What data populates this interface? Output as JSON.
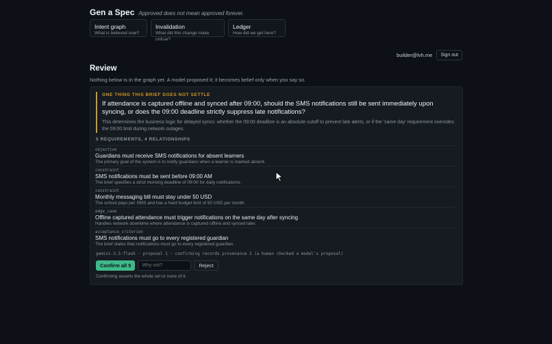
{
  "app": {
    "title": "Gen a Spec",
    "tagline": "Approved does not mean approved forever."
  },
  "nav": [
    {
      "title": "Intent graph",
      "subtitle": "What is believed now?"
    },
    {
      "title": "Invalidation",
      "subtitle": "What did this change make untrue?"
    },
    {
      "title": "Ledger",
      "subtitle": "How did we get here?"
    }
  ],
  "user": {
    "email": "builder@lvh.me",
    "sign_out_label": "Sign out"
  },
  "review": {
    "title": "Review",
    "subtitle": "Nothing below is in the graph yet. A model proposed it; it becomes belief only when you say so."
  },
  "unsettled": {
    "label": "ONE THING THIS BRIEF DOES NOT SETTLE",
    "question": "If attendance is captured offline and synced after 09:00, should the SMS notifications still be sent immediately upon syncing, or does the 09:00 deadline strictly suppress late notifications?",
    "note": "This determines the business logic for delayed syncs: whether the 09:00 deadline is an absolute cutoff to prevent late alerts, or if the 'same day' requirement overrides the 09:00 limit during network outages."
  },
  "counts_label": "5 REQUIREMENTS, 4 RELATIONSHIPS",
  "requirements": [
    {
      "kind": "objective",
      "title": "Guardians must receive SMS notifications for absent learners",
      "desc": "The primary goal of the system is to notify guardians when a learner is marked absent."
    },
    {
      "kind": "constraint",
      "title": "SMS notifications must be sent before 09:00 AM",
      "desc": "The brief specifies a strict morning deadline of 09:00 for daily notifications."
    },
    {
      "kind": "constraint",
      "title": "Monthly messaging bill must stay under 50 USD",
      "desc": "The school pays per SMS and has a hard budget limit of 50 USD per month."
    },
    {
      "kind": "edge_case",
      "title": "Offline captured attendance must trigger notifications on the same day after syncing",
      "desc": "Handles network downtime where attendance is captured offline and synced later."
    },
    {
      "kind": "acceptance_criterion",
      "title": "SMS notifications must go to every registered guardian",
      "desc": "The brief states that notifications must go to every registered guardian."
    }
  ],
  "provenance": "gemini-3.5-flash · proposal 1 · confirming records provenance 2 (a human checked a model's proposal)",
  "actions": {
    "confirm_label": "Confirm all 5",
    "why_not_placeholder": "Why not?",
    "reject_label": "Reject"
  },
  "footnote": "Confirming asserts the whole set or none of it."
}
